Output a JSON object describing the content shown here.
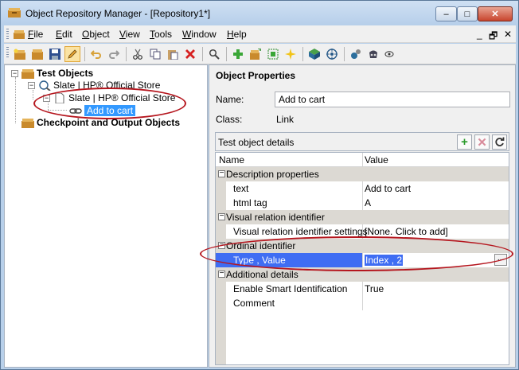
{
  "window": {
    "title": "Object Repository Manager - [Repository1*]",
    "min_label": "–",
    "max_label": "□",
    "close_label": "✕",
    "mdi_min": "_",
    "mdi_restore": "🗗",
    "mdi_close": "✕"
  },
  "menu": {
    "items": [
      {
        "key": "F",
        "rest": "ile"
      },
      {
        "key": "E",
        "rest": "dit"
      },
      {
        "key": "O",
        "rest": "bject"
      },
      {
        "key": "V",
        "rest": "iew"
      },
      {
        "key": "T",
        "rest": "ools"
      },
      {
        "key": "W",
        "rest": "indow"
      },
      {
        "key": "H",
        "rest": "elp"
      }
    ]
  },
  "tree": {
    "test_objects": "Test Objects",
    "browser": "Slate | HP® Official Store",
    "page": "Slate | HP® Official Store",
    "link": "Add to cart",
    "checkpoints": "Checkpoint and Output Objects"
  },
  "properties": {
    "title": "Object Properties",
    "name_label": "Name:",
    "name_value": "Add to cart",
    "class_label": "Class:",
    "class_value": "Link",
    "details_label": "Test object details",
    "col_name": "Name",
    "col_value": "Value",
    "rows": [
      {
        "type": "cat",
        "name": "Description properties"
      },
      {
        "type": "prop",
        "name": "text",
        "value": "Add to cart"
      },
      {
        "type": "prop",
        "name": "html tag",
        "value": "A"
      },
      {
        "type": "cat",
        "name": "Visual relation identifier"
      },
      {
        "type": "prop",
        "name": "Visual relation identifier settings",
        "value": "[None. Click to add]"
      },
      {
        "type": "cat",
        "name": "Ordinal identifier"
      },
      {
        "type": "prop",
        "name": "Type , Value",
        "value": "Index , 2",
        "selected": true
      },
      {
        "type": "cat",
        "name": "Additional details"
      },
      {
        "type": "prop",
        "name": "Enable Smart Identification",
        "value": "True"
      },
      {
        "type": "prop",
        "name": "Comment",
        "value": ""
      }
    ],
    "ellipsis": "..."
  },
  "colors": {
    "selection": "#3399ff",
    "grid_selection": "#3f6df3",
    "annotation": "#b5161e",
    "category_bg": "#dcd9d3"
  }
}
